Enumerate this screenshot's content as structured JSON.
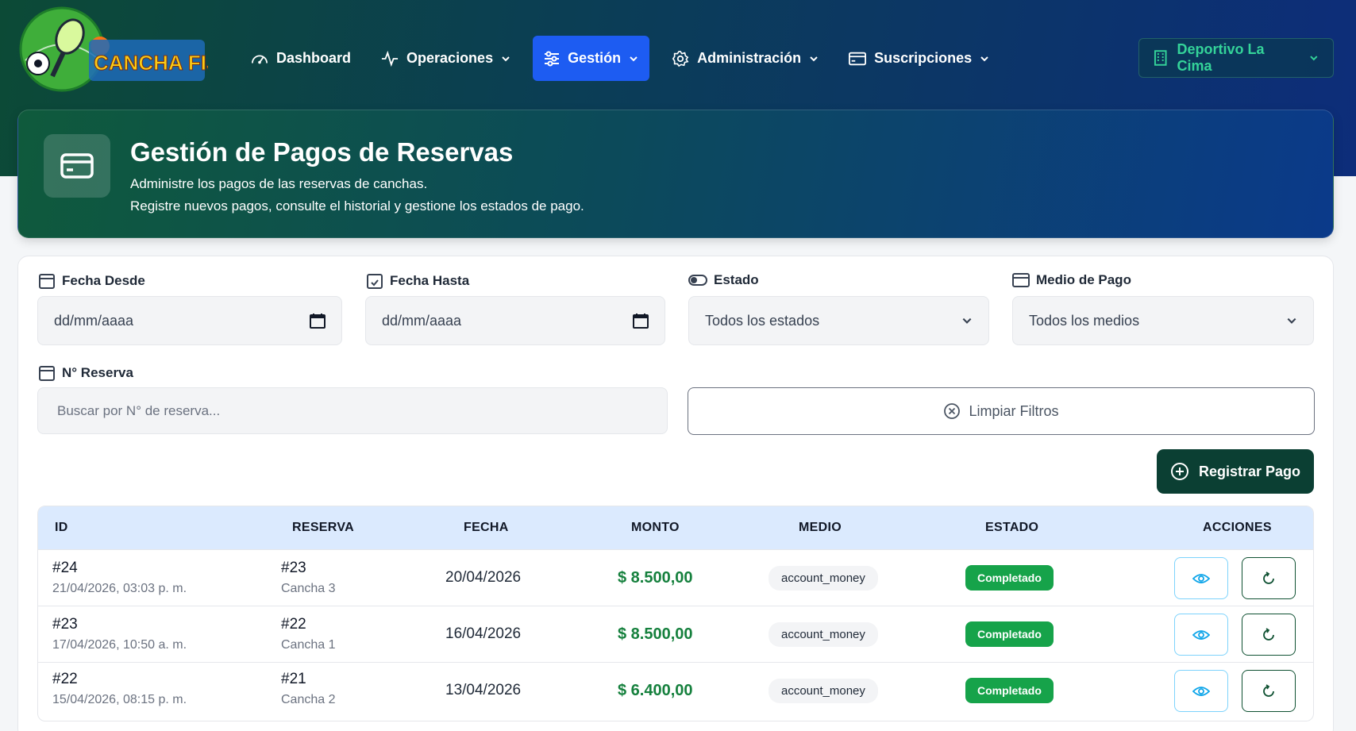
{
  "nav": {
    "logo_text": "CANCHA FIJA",
    "items": [
      {
        "label": "Dashboard"
      },
      {
        "label": "Operaciones"
      },
      {
        "label": "Gestión"
      },
      {
        "label": "Administración"
      },
      {
        "label": "Suscripciones"
      }
    ],
    "company": "Deportivo La Cima"
  },
  "header": {
    "title": "Gestión de Pagos de Reservas",
    "subtitle1": "Administre los pagos de las reservas de canchas.",
    "subtitle2": "Registre nuevos pagos, consulte el historial y gestione los estados de pago."
  },
  "filters": {
    "fecha_desde": {
      "label": "Fecha Desde",
      "value": "dd/mm/aaaa"
    },
    "fecha_hasta": {
      "label": "Fecha Hasta",
      "value": "dd/mm/aaaa"
    },
    "estado": {
      "label": "Estado",
      "value": "Todos los estados"
    },
    "medio": {
      "label": "Medio de Pago",
      "value": "Todos los medios"
    },
    "reserva": {
      "label": "N° Reserva",
      "placeholder": "Buscar por N° de reserva..."
    },
    "clear_label": "Limpiar Filtros"
  },
  "register_label": "Registrar Pago",
  "table": {
    "headers": {
      "id": "ID",
      "reserva": "RESERVA",
      "fecha": "FECHA",
      "monto": "MONTO",
      "medio": "MEDIO",
      "estado": "ESTADO",
      "acciones": "ACCIONES"
    },
    "rows": [
      {
        "id": "#24",
        "created": "21/04/2026, 03:03 p. m.",
        "reserva": "#23",
        "cancha": "Cancha 3",
        "fecha": "20/04/2026",
        "monto": "$ 8.500,00",
        "medio": "account_money",
        "estado": "Completado"
      },
      {
        "id": "#23",
        "created": "17/04/2026, 10:50 a. m.",
        "reserva": "#22",
        "cancha": "Cancha 1",
        "fecha": "16/04/2026",
        "monto": "$ 8.500,00",
        "medio": "account_money",
        "estado": "Completado"
      },
      {
        "id": "#22",
        "created": "15/04/2026, 08:15 p. m.",
        "reserva": "#21",
        "cancha": "Cancha 2",
        "fecha": "13/04/2026",
        "monto": "$ 6.400,00",
        "medio": "account_money",
        "estado": "Completado"
      }
    ]
  }
}
